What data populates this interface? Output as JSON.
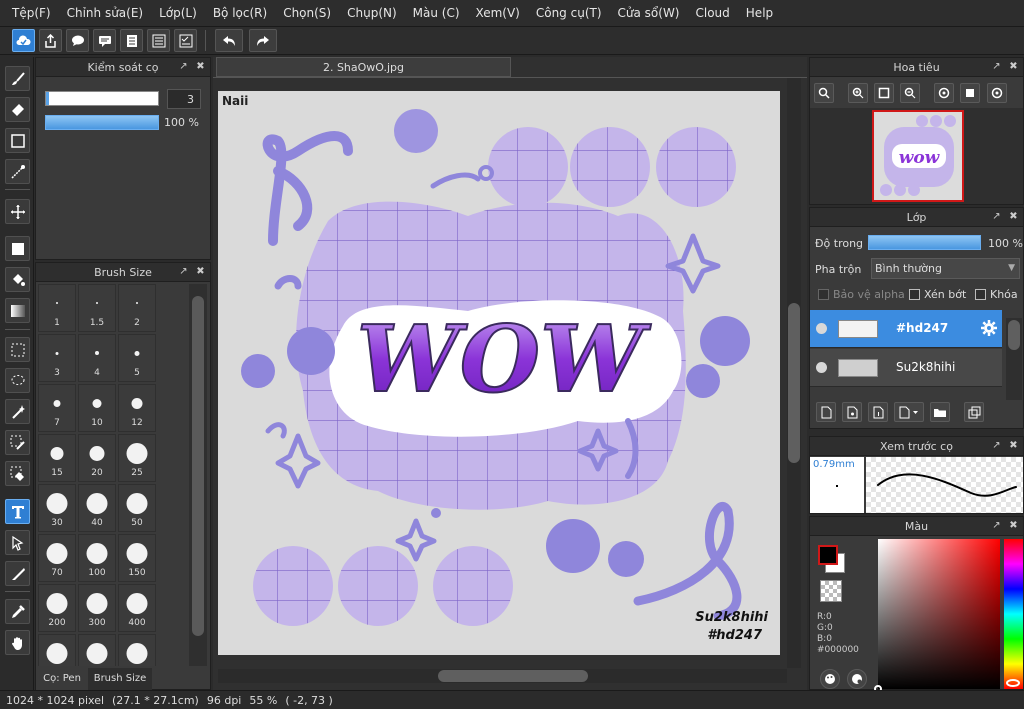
{
  "menu": [
    "Tệp(F)",
    "Chỉnh sửa(E)",
    "Lớp(L)",
    "Bộ lọc(R)",
    "Chọn(S)",
    "Chụp(N)",
    "Màu (C)",
    "Xem(V)",
    "Công cụ(T)",
    "Cửa sổ(W)",
    "Cloud",
    "Help"
  ],
  "brush_control": {
    "title": "Kiểm soát cọ",
    "size_value": "3",
    "opacity_value": "100 %"
  },
  "brush_size": {
    "title": "Brush Size",
    "sizes": [
      "1",
      "1.5",
      "2",
      "3",
      "4",
      "5",
      "7",
      "10",
      "12",
      "15",
      "20",
      "25",
      "30",
      "40",
      "50",
      "70",
      "100",
      "150",
      "200",
      "300",
      "400",
      "",
      "",
      ""
    ],
    "tabs": [
      "Cọ: Pen",
      "Brush Size"
    ]
  },
  "document": {
    "tab_title": "2. ShaOwO.jpg",
    "text_top_left": "Naii",
    "text_bottom_right_1": "Su2k8hihi",
    "text_bottom_right_2": "#hd247",
    "main_text": "WOW"
  },
  "navigator": {
    "title": "Hoa tiêu"
  },
  "layers": {
    "title": "Lớp",
    "opacity_label": "Độ trong",
    "opacity_value": "100 %",
    "opacity": 100,
    "blend_label": "Pha trộn",
    "blend_value": "Bình thường",
    "protect_alpha": "Bảo vệ alpha",
    "clipping": "Xén bớt",
    "lock": "Khóa",
    "items": [
      {
        "name": "#hd247",
        "selected": true
      },
      {
        "name": "Su2k8hihi",
        "selected": false
      }
    ]
  },
  "brush_preview": {
    "title": "Xem trước cọ",
    "size_label": "0.79mm"
  },
  "color": {
    "title": "Màu",
    "r": "R:0",
    "g": "G:0",
    "b": "B:0",
    "hex": "#000000",
    "fg": "#000000",
    "bg": "#ffffff"
  },
  "status": {
    "dimensions": "1024 * 1024 pixel",
    "physical": "(27.1 * 27.1cm)",
    "dpi": "96 dpi",
    "zoom": "55 %",
    "coords": "( -2, 73 )"
  },
  "colors": {
    "accent": "#2f7fd3",
    "purple": "#8f86db",
    "lavender": "#b9a8e4"
  }
}
